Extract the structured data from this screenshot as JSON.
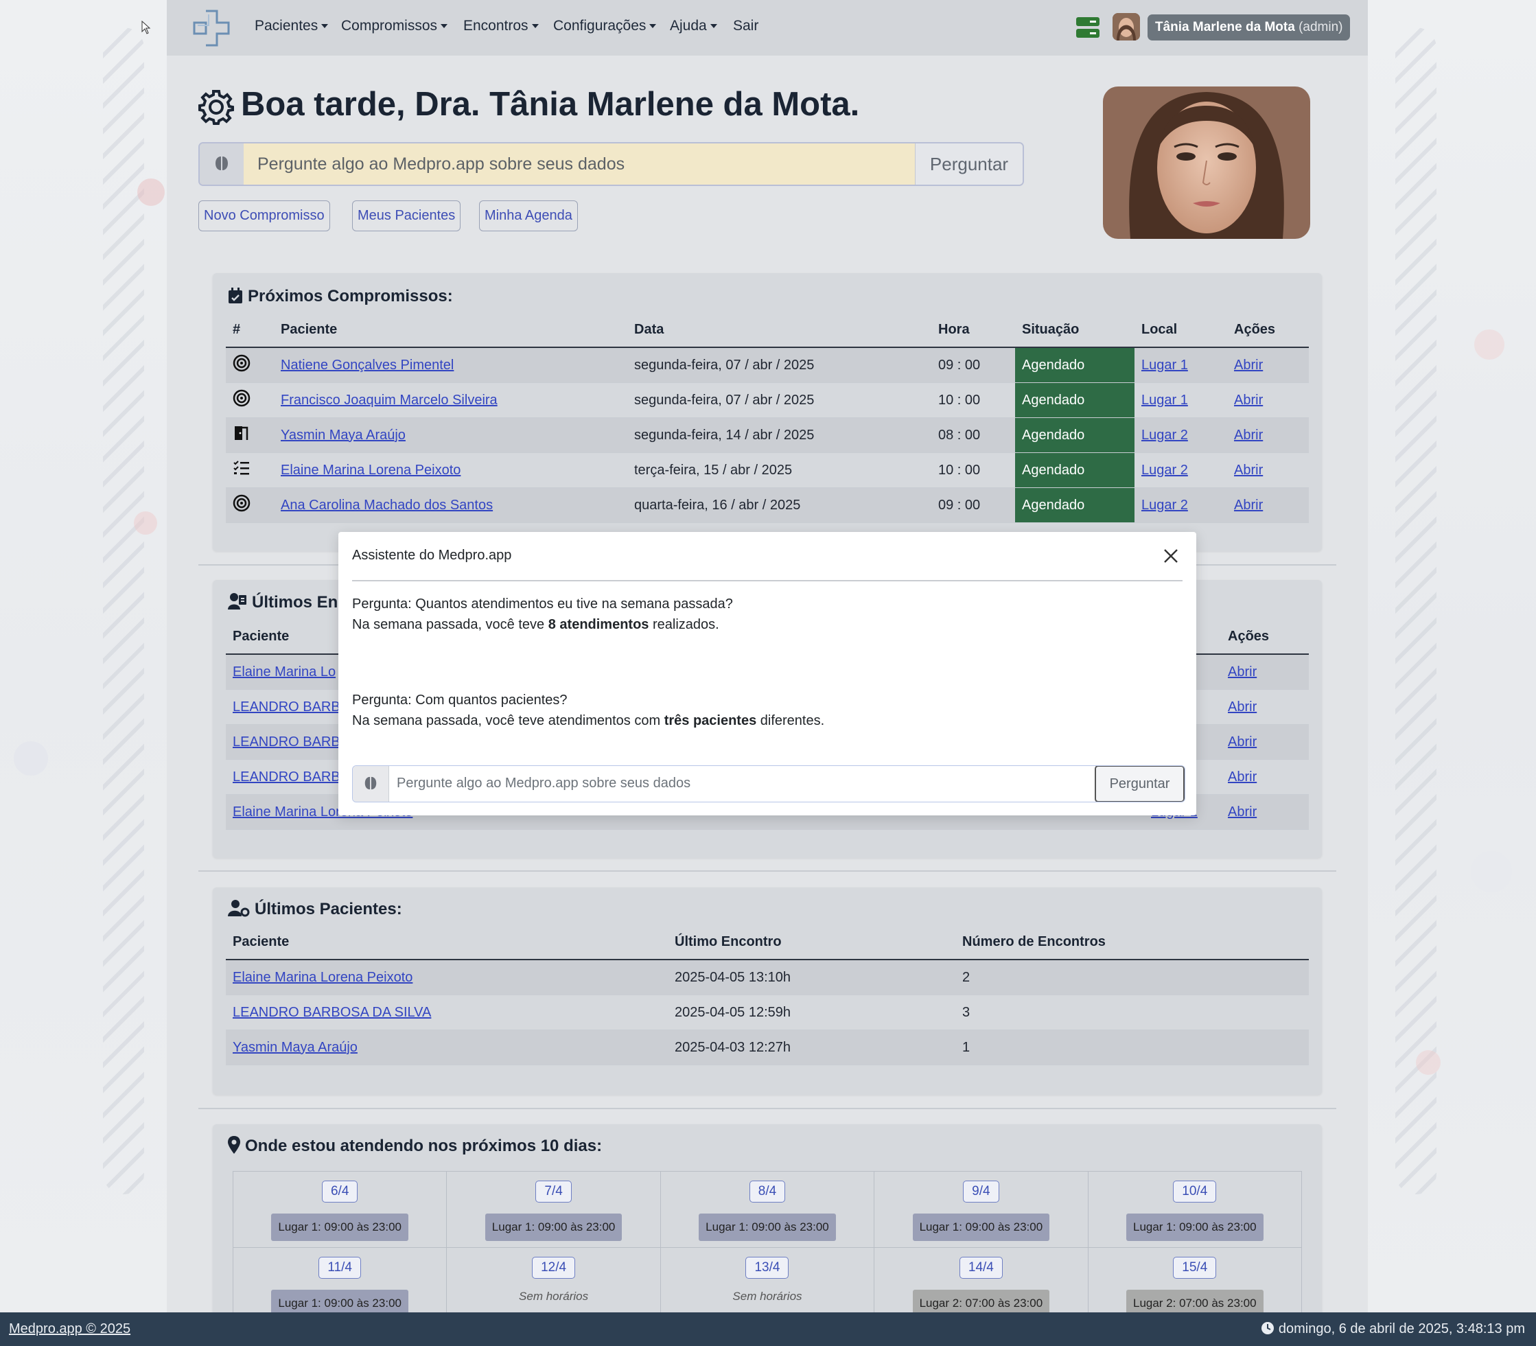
{
  "nav": {
    "items": [
      {
        "label": "Pacientes",
        "dropdown": true
      },
      {
        "label": "Compromissos",
        "dropdown": true
      },
      {
        "label": "Encontros",
        "dropdown": true
      },
      {
        "label": "Configurações",
        "dropdown": true
      },
      {
        "label": "Ajuda",
        "dropdown": true
      },
      {
        "label": "Sair",
        "dropdown": false
      }
    ],
    "user_name": "Tânia Marlene da Mota",
    "user_role": "(admin)"
  },
  "greeting": "Boa tarde, Dra. Tânia Marlene da Mota.",
  "ask": {
    "placeholder": "Pergunte algo ao Medpro.app sobre seus dados",
    "button": "Perguntar"
  },
  "quick_buttons": [
    "Novo Compromisso",
    "Meus Pacientes",
    "Minha Agenda"
  ],
  "appointments": {
    "title": "Próximos Compromissos:",
    "headers": [
      "#",
      "Paciente",
      "Data",
      "Hora",
      "Situação",
      "Local",
      "Ações"
    ],
    "rows": [
      {
        "icon": "target-icon",
        "patient": "Natiene Gonçalves Pimentel",
        "date": "segunda-feira, 07 / abr / 2025",
        "time": "09 : 00",
        "status": "Agendado",
        "place": "Lugar 1",
        "action": "Abrir"
      },
      {
        "icon": "target-icon",
        "patient": "Francisco Joaquim Marcelo Silveira",
        "date": "segunda-feira, 07 / abr / 2025",
        "time": "10 : 00",
        "status": "Agendado",
        "place": "Lugar 1",
        "action": "Abrir"
      },
      {
        "icon": "door-icon",
        "patient": "Yasmin Maya Araújo",
        "date": "segunda-feira, 14 / abr / 2025",
        "time": "08 : 00",
        "status": "Agendado",
        "place": "Lugar 2",
        "action": "Abrir"
      },
      {
        "icon": "checklist-icon",
        "patient": "Elaine Marina Lorena Peixoto",
        "date": "terça-feira, 15 / abr / 2025",
        "time": "10 : 00",
        "status": "Agendado",
        "place": "Lugar 2",
        "action": "Abrir"
      },
      {
        "icon": "target-icon",
        "patient": "Ana Carolina Machado dos Santos",
        "date": "quarta-feira, 16 / abr / 2025",
        "time": "09 : 00",
        "status": "Agendado",
        "place": "Lugar 2",
        "action": "Abrir"
      }
    ]
  },
  "encounters": {
    "title": "Últimos Enc",
    "headers": [
      "Paciente",
      "Ações"
    ],
    "rows": [
      {
        "patient": "Elaine Marina Lo",
        "place": "",
        "action": "Abrir"
      },
      {
        "patient": "LEANDRO BARBC",
        "place": "",
        "action": "Abrir"
      },
      {
        "patient": "LEANDRO BARBC",
        "place": "",
        "action": "Abrir"
      },
      {
        "patient": "LEANDRO BARBC",
        "place": "",
        "action": "Abrir"
      },
      {
        "patient": "Elaine Marina Lorena Peixoto",
        "place": "Lugar 1",
        "action": "Abrir"
      }
    ]
  },
  "patients": {
    "title": "Últimos Pacientes:",
    "headers": [
      "Paciente",
      "Último Encontro",
      "Número de Encontros"
    ],
    "rows": [
      {
        "patient": "Elaine Marina Lorena Peixoto",
        "last": "2025-04-05 13:10h",
        "count": "2"
      },
      {
        "patient": "LEANDRO BARBOSA DA SILVA",
        "last": "2025-04-05 12:59h",
        "count": "3"
      },
      {
        "patient": "Yasmin Maya Araújo",
        "last": "2025-04-03 12:27h",
        "count": "1"
      }
    ]
  },
  "schedule": {
    "title": "Onde estou atendendo nos próximos 10 dias:",
    "days": [
      {
        "date": "6/4",
        "slot": "Lugar 1: 09:00 às 23:00",
        "place": "1"
      },
      {
        "date": "7/4",
        "slot": "Lugar 1: 09:00 às 23:00",
        "place": "1"
      },
      {
        "date": "8/4",
        "slot": "Lugar 1: 09:00 às 23:00",
        "place": "1"
      },
      {
        "date": "9/4",
        "slot": "Lugar 1: 09:00 às 23:00",
        "place": "1"
      },
      {
        "date": "10/4",
        "slot": "Lugar 1: 09:00 às 23:00",
        "place": "1"
      },
      {
        "date": "11/4",
        "slot": "Lugar 1: 09:00 às 23:00",
        "place": "1"
      },
      {
        "date": "12/4",
        "slot": "Sem horários",
        "place": "none"
      },
      {
        "date": "13/4",
        "slot": "Sem horários",
        "place": "none"
      },
      {
        "date": "14/4",
        "slot": "Lugar 2: 07:00 às 23:00",
        "place": "2"
      },
      {
        "date": "15/4",
        "slot": "Lugar 2: 07:00 às 23:00",
        "place": "2"
      }
    ]
  },
  "modal": {
    "title": "Assistente do Medpro.app",
    "q1": "Pergunta: Quantos atendimentos eu tive na semana passada?",
    "a1_pre": "Na semana passada, você teve ",
    "a1_bold": "8 atendimentos",
    "a1_post": " realizados.",
    "q2": "Pergunta: Com quantos pacientes?",
    "a2_pre": "Na semana passada, você teve atendimentos com ",
    "a2_bold": "três pacientes",
    "a2_post": " diferentes.",
    "placeholder": "Pergunte algo ao Medpro.app sobre seus dados",
    "button": "Perguntar"
  },
  "footer": {
    "copyright": "Medpro.app © 2025",
    "datetime": "domingo, 6 de abril de 2025, 3:48:13 pm"
  },
  "colors": {
    "status_scheduled": "#2e6b45",
    "navbar": "#d3d6da",
    "footer": "#2d3f52",
    "link": "#3245c2"
  }
}
